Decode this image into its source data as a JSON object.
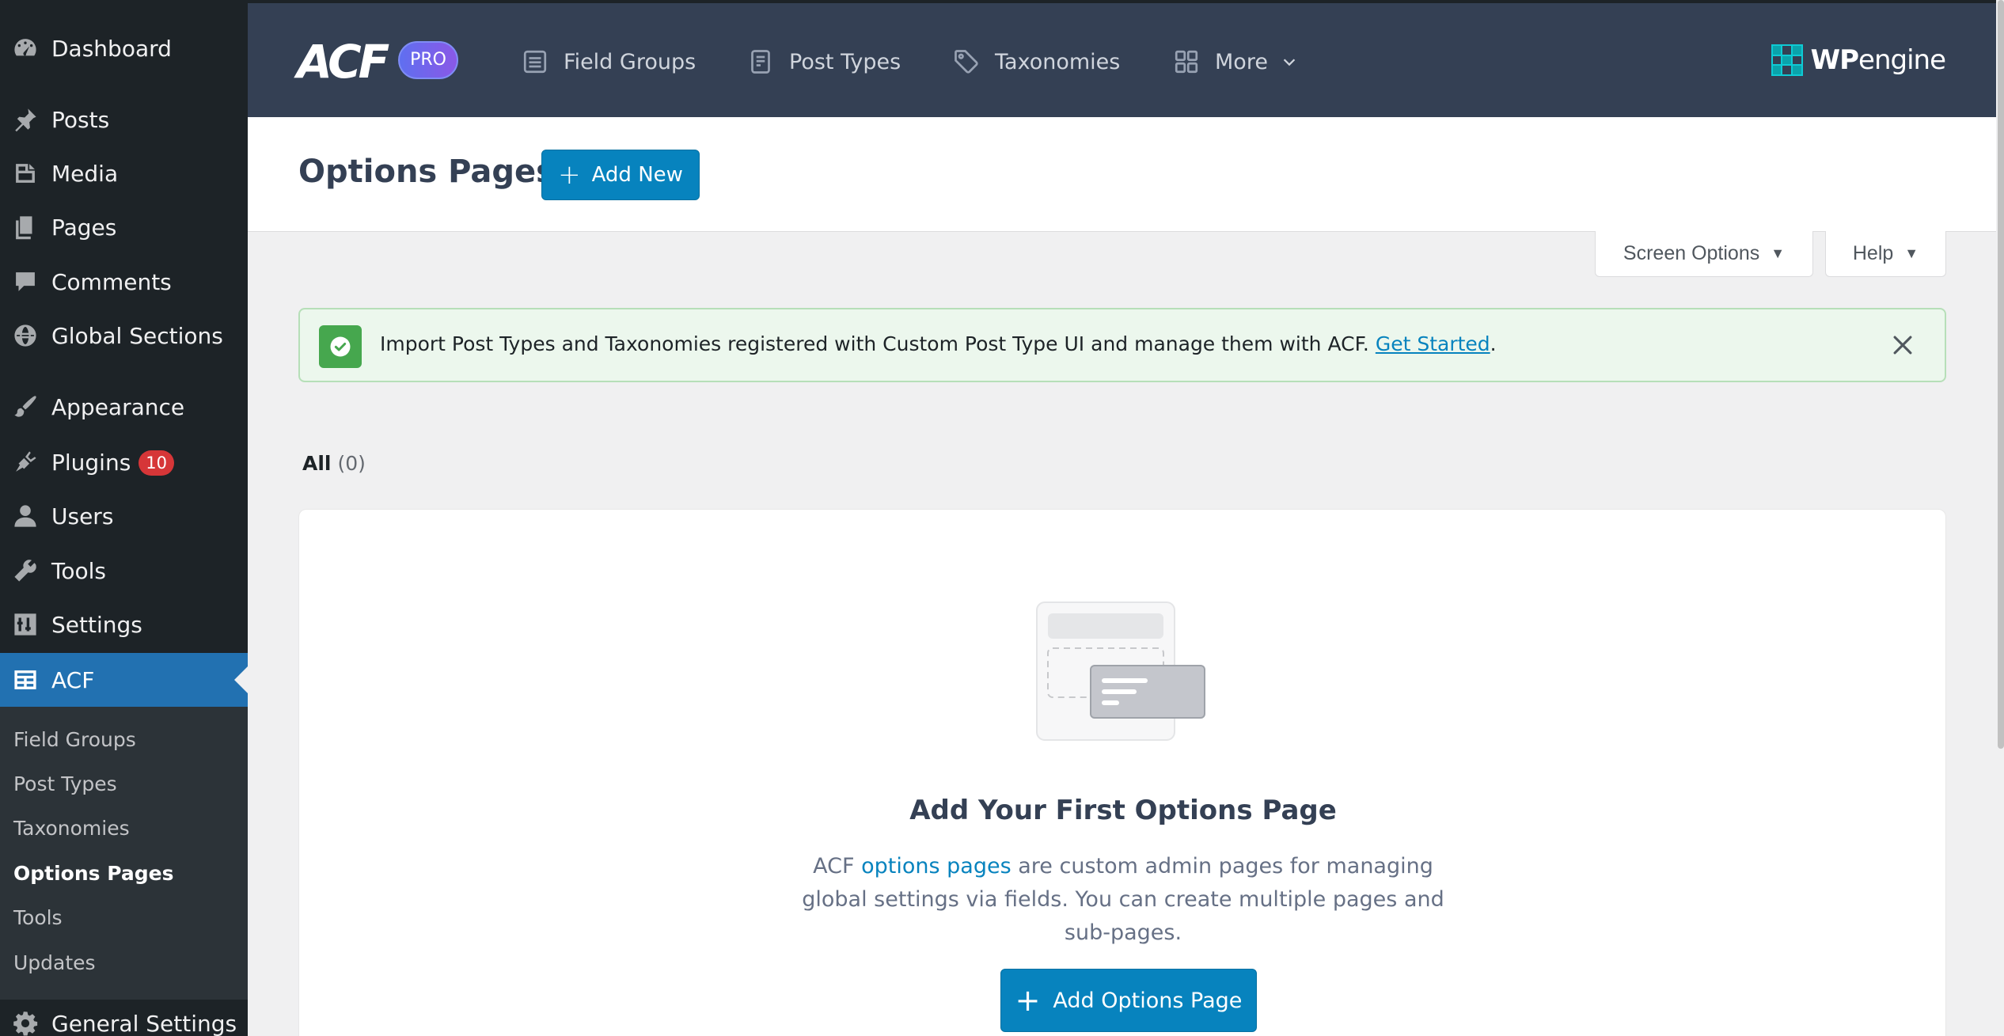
{
  "sidebar": {
    "items": [
      {
        "id": "dashboard",
        "label": "Dashboard",
        "icon": "dashboard-icon"
      },
      {
        "id": "posts",
        "label": "Posts",
        "icon": "pin-icon"
      },
      {
        "id": "media",
        "label": "Media",
        "icon": "media-icon"
      },
      {
        "id": "pages",
        "label": "Pages",
        "icon": "pages-icon"
      },
      {
        "id": "comments",
        "label": "Comments",
        "icon": "comment-icon"
      },
      {
        "id": "global-sections",
        "label": "Global Sections",
        "icon": "globe-icon"
      },
      {
        "id": "appearance",
        "label": "Appearance",
        "icon": "paintbrush-icon"
      },
      {
        "id": "plugins",
        "label": "Plugins",
        "icon": "plugin-icon",
        "badge": "10"
      },
      {
        "id": "users",
        "label": "Users",
        "icon": "user-icon"
      },
      {
        "id": "tools",
        "label": "Tools",
        "icon": "wrench-icon"
      },
      {
        "id": "settings",
        "label": "Settings",
        "icon": "settings-icon"
      },
      {
        "id": "acf",
        "label": "ACF",
        "icon": "acf-table-icon",
        "current": true
      },
      {
        "id": "general-settings",
        "label": "General Settings",
        "icon": "gear-icon"
      }
    ],
    "acf_submenu": [
      {
        "label": "Field Groups"
      },
      {
        "label": "Post Types"
      },
      {
        "label": "Taxonomies"
      },
      {
        "label": "Options Pages",
        "active": true
      },
      {
        "label": "Tools"
      },
      {
        "label": "Updates"
      }
    ]
  },
  "header": {
    "logo": "ACF",
    "pro_badge": "PRO",
    "tabs": [
      {
        "label": "Field Groups",
        "icon": "list-icon"
      },
      {
        "label": "Post Types",
        "icon": "document-icon"
      },
      {
        "label": "Taxonomies",
        "icon": "tag-icon"
      },
      {
        "label": "More",
        "icon": "grid-icon",
        "dropdown": true
      }
    ],
    "partner_logo": {
      "bold": "WP",
      "rest": "engine"
    }
  },
  "titlebar": {
    "title": "Options Pages",
    "add_new_label": "Add New"
  },
  "meta_links": {
    "screen_options": "Screen Options",
    "help": "Help"
  },
  "notice": {
    "text": "Import Post Types and Taxonomies registered with Custom Post Type UI and manage them with ACF.",
    "link_label": "Get Started",
    "suffix": "."
  },
  "filter": {
    "all_label": "All",
    "all_count": "(0)"
  },
  "empty_state": {
    "title": "Add Your First Options Page",
    "desc_prefix": "ACF",
    "desc_link": "options pages",
    "desc_suffix": "are custom admin pages for managing global settings via fields. You can create multiple pages and sub-pages.",
    "button_label": "Add Options Page"
  },
  "colors": {
    "sidebar_bg": "#1d2327",
    "acf_header_bg": "#344054",
    "primary": "#0783be",
    "wp_current": "#2271b1",
    "badge_red": "#d63638",
    "notice_green": "#46a74e"
  }
}
